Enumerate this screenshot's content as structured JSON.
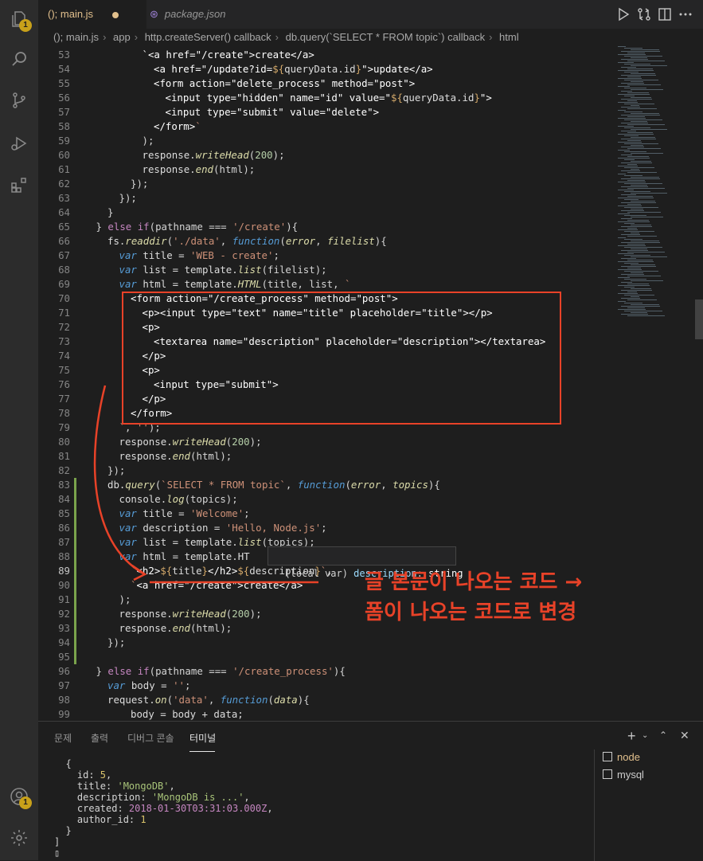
{
  "tabs": [
    {
      "label": "(); main.js",
      "active": true,
      "modified": true
    },
    {
      "label": "package.json",
      "active": false
    }
  ],
  "breadcrumb": [
    "(); main.js",
    "app",
    "http.createServer() callback",
    "db.query(`SELECT * FROM topic`) callback",
    "html"
  ],
  "activity_badges": {
    "explorer": "1",
    "accounts": "1"
  },
  "editor": {
    "current_line": 89,
    "lines": [
      {
        "n": "53",
        "i": 5,
        "t": [
          [
            "tag",
            "`<a href=\"/create\">create</a>"
          ]
        ]
      },
      {
        "n": "54",
        "i": 6,
        "t": [
          [
            "tag",
            "<a href=\"/update?id="
          ],
          [
            "par",
            "${"
          ],
          [
            "id",
            "queryData.id"
          ],
          [
            "par",
            "}"
          ],
          [
            "tag",
            "\">update</a>"
          ]
        ]
      },
      {
        "n": "55",
        "i": 6,
        "t": [
          [
            "tag",
            "<form action=\"delete_process\" method=\"post\">"
          ]
        ]
      },
      {
        "n": "56",
        "i": 7,
        "t": [
          [
            "tag",
            "<input type=\"hidden\" name=\"id\" value=\""
          ],
          [
            "par",
            "${"
          ],
          [
            "id",
            "queryData.id"
          ],
          [
            "par",
            "}"
          ],
          [
            "tag",
            "\">"
          ]
        ]
      },
      {
        "n": "57",
        "i": 7,
        "t": [
          [
            "tag",
            "<input type=\"submit\" value=\"delete\">"
          ]
        ]
      },
      {
        "n": "58",
        "i": 6,
        "t": [
          [
            "tag",
            "</form>"
          ],
          [
            "str",
            "`"
          ]
        ]
      },
      {
        "n": "59",
        "i": 5,
        "t": [
          [
            "op",
            ");"
          ]
        ]
      },
      {
        "n": "60",
        "i": 5,
        "t": [
          [
            "id",
            "response."
          ],
          [
            "fn",
            "writeHead"
          ],
          [
            "op",
            "("
          ],
          [
            "num",
            "200"
          ],
          [
            "op",
            ");"
          ]
        ]
      },
      {
        "n": "61",
        "i": 5,
        "t": [
          [
            "id",
            "response."
          ],
          [
            "fn",
            "end"
          ],
          [
            "op",
            "(html);"
          ]
        ]
      },
      {
        "n": "62",
        "i": 4,
        "t": [
          [
            "op",
            "});"
          ]
        ]
      },
      {
        "n": "63",
        "i": 3,
        "t": [
          [
            "op",
            "});"
          ]
        ]
      },
      {
        "n": "64",
        "i": 2,
        "t": [
          [
            "op",
            "}"
          ]
        ]
      },
      {
        "n": "65",
        "i": 1,
        "t": [
          [
            "op",
            "} "
          ],
          [
            "kw",
            "else if"
          ],
          [
            "op",
            "(pathname === "
          ],
          [
            "str",
            "'/create'"
          ],
          [
            "op",
            "){"
          ]
        ]
      },
      {
        "n": "66",
        "i": 2,
        "t": [
          [
            "id",
            "fs."
          ],
          [
            "fn",
            "readdir"
          ],
          [
            "op",
            "("
          ],
          [
            "str",
            "'./data'"
          ],
          [
            "op",
            ", "
          ],
          [
            "var",
            "function"
          ],
          [
            "op",
            "("
          ],
          [
            "fn",
            "error"
          ],
          [
            "op",
            ", "
          ],
          [
            "fn",
            "filelist"
          ],
          [
            "op",
            "){"
          ]
        ]
      },
      {
        "n": "67",
        "i": 3,
        "t": [
          [
            "var",
            "var"
          ],
          [
            "id",
            " title = "
          ],
          [
            "str",
            "'WEB - create'"
          ],
          [
            "op",
            ";"
          ]
        ]
      },
      {
        "n": "68",
        "i": 3,
        "t": [
          [
            "var",
            "var"
          ],
          [
            "id",
            " list = template."
          ],
          [
            "fn",
            "list"
          ],
          [
            "op",
            "(filelist);"
          ]
        ]
      },
      {
        "n": "69",
        "i": 3,
        "t": [
          [
            "var",
            "var"
          ],
          [
            "id",
            " html = template."
          ],
          [
            "fn",
            "HTML"
          ],
          [
            "op",
            "(title, list, "
          ],
          [
            "str",
            "`"
          ]
        ]
      },
      {
        "n": "70",
        "i": 4,
        "t": [
          [
            "tag",
            "<form action=\"/create_process\" method=\"post\">"
          ]
        ]
      },
      {
        "n": "71",
        "i": 5,
        "t": [
          [
            "tag",
            "<p><input type=\"text\" name=\"title\" placeholder=\"title\"></p>"
          ]
        ]
      },
      {
        "n": "72",
        "i": 5,
        "t": [
          [
            "tag",
            "<p>"
          ]
        ]
      },
      {
        "n": "73",
        "i": 6,
        "t": [
          [
            "tag",
            "<textarea name=\"description\" placeholder=\"description\"></textarea>"
          ]
        ]
      },
      {
        "n": "74",
        "i": 5,
        "t": [
          [
            "tag",
            "</p>"
          ]
        ]
      },
      {
        "n": "75",
        "i": 5,
        "t": [
          [
            "tag",
            "<p>"
          ]
        ]
      },
      {
        "n": "76",
        "i": 6,
        "t": [
          [
            "tag",
            "<input type=\"submit\">"
          ]
        ]
      },
      {
        "n": "77",
        "i": 5,
        "t": [
          [
            "tag",
            "</p>"
          ]
        ]
      },
      {
        "n": "78",
        "i": 4,
        "t": [
          [
            "tag",
            "</form>"
          ]
        ]
      },
      {
        "n": "79",
        "i": 3,
        "t": [
          [
            "str",
            "`"
          ],
          [
            "op",
            ", "
          ],
          [
            "str",
            "''"
          ],
          [
            "op",
            ");"
          ]
        ]
      },
      {
        "n": "80",
        "i": 3,
        "t": [
          [
            "id",
            "response."
          ],
          [
            "fn",
            "writeHead"
          ],
          [
            "op",
            "("
          ],
          [
            "num",
            "200"
          ],
          [
            "op",
            ");"
          ]
        ]
      },
      {
        "n": "81",
        "i": 3,
        "t": [
          [
            "id",
            "response."
          ],
          [
            "fn",
            "end"
          ],
          [
            "op",
            "(html);"
          ]
        ]
      },
      {
        "n": "82",
        "i": 2,
        "t": [
          [
            "op",
            "});"
          ]
        ]
      },
      {
        "n": "83",
        "i": 2,
        "t": [
          [
            "id",
            "db."
          ],
          [
            "fn",
            "query"
          ],
          [
            "op",
            "("
          ],
          [
            "str",
            "`SELECT * FROM topic`"
          ],
          [
            "op",
            ", "
          ],
          [
            "var",
            "function"
          ],
          [
            "op",
            "("
          ],
          [
            "fn",
            "error"
          ],
          [
            "op",
            ", "
          ],
          [
            "fn",
            "topics"
          ],
          [
            "op",
            "){"
          ]
        ]
      },
      {
        "n": "84",
        "i": 3,
        "t": [
          [
            "id",
            "console."
          ],
          [
            "fn",
            "log"
          ],
          [
            "op",
            "(topics);"
          ]
        ]
      },
      {
        "n": "85",
        "i": 3,
        "t": [
          [
            "var",
            "var"
          ],
          [
            "id",
            " title = "
          ],
          [
            "str",
            "'Welcome'"
          ],
          [
            "op",
            ";"
          ]
        ]
      },
      {
        "n": "86",
        "i": 3,
        "t": [
          [
            "var",
            "var"
          ],
          [
            "id",
            " description = "
          ],
          [
            "str",
            "'Hello, Node.js'"
          ],
          [
            "op",
            ";"
          ]
        ]
      },
      {
        "n": "87",
        "i": 3,
        "t": [
          [
            "var",
            "var"
          ],
          [
            "id",
            " list = template."
          ],
          [
            "fn",
            "list"
          ],
          [
            "op",
            "(topics);"
          ]
        ]
      },
      {
        "n": "88",
        "i": 3,
        "t": [
          [
            "var",
            "var"
          ],
          [
            "id",
            " html = template.HT"
          ]
        ]
      },
      {
        "n": "89",
        "i": 4,
        "t": [
          [
            "str",
            "`"
          ],
          [
            "tag",
            "<h2>"
          ],
          [
            "par",
            "${"
          ],
          [
            "id",
            "title"
          ],
          [
            "par",
            "}"
          ],
          [
            "tag",
            "</h2>"
          ],
          [
            "par",
            "${"
          ],
          [
            "id",
            "description"
          ],
          [
            "par",
            "}"
          ],
          [
            "str",
            "`"
          ],
          [
            "op",
            ","
          ]
        ]
      },
      {
        "n": "90",
        "i": 4,
        "t": [
          [
            "str",
            "`"
          ],
          [
            "tag",
            "<a href=\"/create\">create</a>"
          ]
        ]
      },
      {
        "n": "91",
        "i": 3,
        "t": [
          [
            "op",
            ");"
          ]
        ]
      },
      {
        "n": "92",
        "i": 3,
        "t": [
          [
            "id",
            "response."
          ],
          [
            "fn",
            "writeHead"
          ],
          [
            "op",
            "("
          ],
          [
            "num",
            "200"
          ],
          [
            "op",
            ");"
          ]
        ]
      },
      {
        "n": "93",
        "i": 3,
        "t": [
          [
            "id",
            "response."
          ],
          [
            "fn",
            "end"
          ],
          [
            "op",
            "(html);"
          ]
        ]
      },
      {
        "n": "94",
        "i": 2,
        "t": [
          [
            "op",
            "});"
          ]
        ]
      },
      {
        "n": "95",
        "i": 0,
        "t": []
      },
      {
        "n": "96",
        "i": 1,
        "t": [
          [
            "op",
            "} "
          ],
          [
            "kw",
            "else if"
          ],
          [
            "op",
            "(pathname === "
          ],
          [
            "str",
            "'/create_process'"
          ],
          [
            "op",
            "){"
          ]
        ]
      },
      {
        "n": "97",
        "i": 2,
        "t": [
          [
            "var",
            "var"
          ],
          [
            "id",
            " body = "
          ],
          [
            "str",
            "''"
          ],
          [
            "op",
            ";"
          ]
        ]
      },
      {
        "n": "98",
        "i": 2,
        "t": [
          [
            "id",
            "request."
          ],
          [
            "fn",
            "on"
          ],
          [
            "op",
            "("
          ],
          [
            "str",
            "'data'"
          ],
          [
            "op",
            ", "
          ],
          [
            "var",
            "function"
          ],
          [
            "op",
            "("
          ],
          [
            "fn",
            "data"
          ],
          [
            "op",
            "){"
          ]
        ]
      },
      {
        "n": "99",
        "i": 4,
        "t": [
          [
            "id",
            "body = body + data;"
          ]
        ]
      }
    ]
  },
  "hover_tooltip": {
    "kind": "(local var)",
    "name": "description",
    "sep": ":",
    "type": "string"
  },
  "annotation": {
    "line1": "글 본문이 나오는 코드 →",
    "line2": "폼이 나오는 코드로 변경"
  },
  "panel": {
    "tabs": [
      "문제",
      "출력",
      "디버그 콘솔",
      "터미널"
    ],
    "active_tab": "터미널",
    "terminal_lines": [
      [
        [
          "p",
          "  {"
        ]
      ],
      [
        [
          "p",
          "    id: "
        ],
        [
          "n",
          "5"
        ],
        [
          "p",
          ","
        ]
      ],
      [
        [
          "p",
          "    title: "
        ],
        [
          "s",
          "'MongoDB'"
        ],
        [
          "p",
          ","
        ]
      ],
      [
        [
          "p",
          "    description: "
        ],
        [
          "s",
          "'MongoDB is ...'"
        ],
        [
          "p",
          ","
        ]
      ],
      [
        [
          "p",
          "    created: "
        ],
        [
          "d",
          "2018-01-30T03:31:03.000Z"
        ],
        [
          "p",
          ","
        ]
      ],
      [
        [
          "p",
          "    author_id: "
        ],
        [
          "n",
          "1"
        ]
      ],
      [
        [
          "p",
          "  }"
        ]
      ],
      [
        [
          "p",
          "]"
        ]
      ],
      [
        [
          "p",
          "▯"
        ]
      ]
    ],
    "terminals": [
      {
        "label": "node",
        "active": true
      },
      {
        "label": "mysql",
        "active": false
      }
    ]
  },
  "colors": {
    "accent_red": "#e84228",
    "background": "#1e1e1e",
    "activity_bar": "#2c2c2c",
    "badge": "#c8a11a"
  }
}
